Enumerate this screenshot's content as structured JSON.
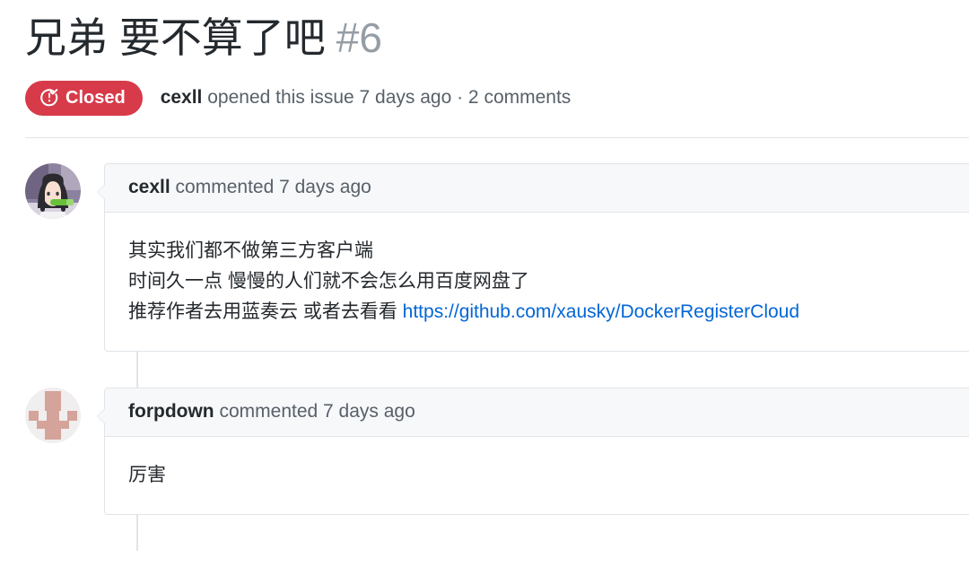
{
  "issue": {
    "title": "兄弟 要不算了吧",
    "number": "#6",
    "state_label": "Closed",
    "state_color": "#d73a49",
    "state_icon": "issue-closed-icon",
    "meta_author": "cexll",
    "meta_text": " opened this issue 7 days ago · 2 comments"
  },
  "comments": [
    {
      "author": "cexll",
      "action": " commented 7 days ago",
      "avatar_icon": "anime-avatar-image",
      "lines": [
        "其实我们都不做第三方客户端",
        "时间久一点 慢慢的人们就不会怎么用百度网盘了"
      ],
      "last_line_prefix": "推荐作者去用蓝奏云 或者去看看 ",
      "link_text": "https://github.com/xausky/DockerRegisterCloud",
      "link_color": "#0366d6"
    },
    {
      "author": "forpdown",
      "action": " commented 7 days ago",
      "avatar_icon": "identicon-avatar",
      "lines": [
        "厉害"
      ],
      "last_line_prefix": "",
      "link_text": "",
      "link_color": "#0366d6"
    }
  ],
  "colors": {
    "text": "#24292e",
    "muted": "#586069",
    "number_muted": "#959da5",
    "border": "#e1e4e8",
    "head_bg": "#f6f8fa",
    "identicon": "#d4a39a",
    "identicon_bg": "#f0eeee"
  }
}
